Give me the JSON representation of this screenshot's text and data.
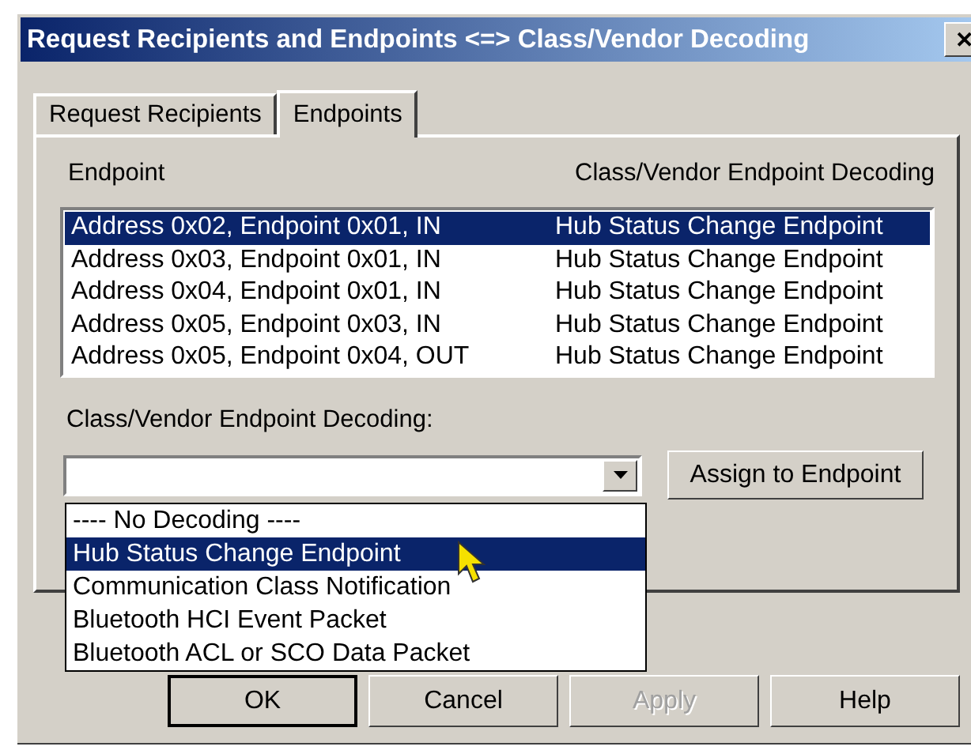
{
  "window": {
    "title": "Request Recipients and Endpoints <=> Class/Vendor Decoding",
    "close": "✕"
  },
  "tabs": [
    {
      "label": "Request Recipients",
      "selected": false
    },
    {
      "label": "Endpoints",
      "selected": true
    }
  ],
  "endpoint_list": {
    "columns": [
      "Endpoint",
      "Class/Vendor Endpoint Decoding"
    ],
    "rows": [
      {
        "endpoint": "Address 0x02, Endpoint 0x01, IN",
        "decoding": "Hub Status Change Endpoint",
        "selected": true
      },
      {
        "endpoint": "Address 0x03, Endpoint 0x01, IN",
        "decoding": "Hub Status Change Endpoint",
        "selected": false
      },
      {
        "endpoint": "Address 0x04, Endpoint 0x01, IN",
        "decoding": "Hub Status Change Endpoint",
        "selected": false
      },
      {
        "endpoint": "Address 0x05, Endpoint 0x03, IN",
        "decoding": "Hub Status Change Endpoint",
        "selected": false
      },
      {
        "endpoint": "Address 0x05, Endpoint 0x04, OUT",
        "decoding": "Hub Status Change Endpoint",
        "selected": false
      }
    ]
  },
  "decoding_label": "Class/Vendor Endpoint Decoding:",
  "decoding_combo": {
    "expanded": true,
    "options": [
      {
        "label": "---- No Decoding ----",
        "selected": false
      },
      {
        "label": "Hub Status Change Endpoint",
        "selected": true
      },
      {
        "label": "Communication Class Notification",
        "selected": false
      },
      {
        "label": "Bluetooth HCI Event Packet",
        "selected": false
      },
      {
        "label": "Bluetooth ACL or SCO Data Packet",
        "selected": false
      }
    ]
  },
  "assign_button": "Assign to Endpoint",
  "buttons": [
    {
      "label": "OK",
      "disabled": false,
      "default": true
    },
    {
      "label": "Cancel",
      "disabled": false,
      "default": false
    },
    {
      "label": "Apply",
      "disabled": true,
      "default": false
    },
    {
      "label": "Help",
      "disabled": false,
      "default": false
    }
  ]
}
